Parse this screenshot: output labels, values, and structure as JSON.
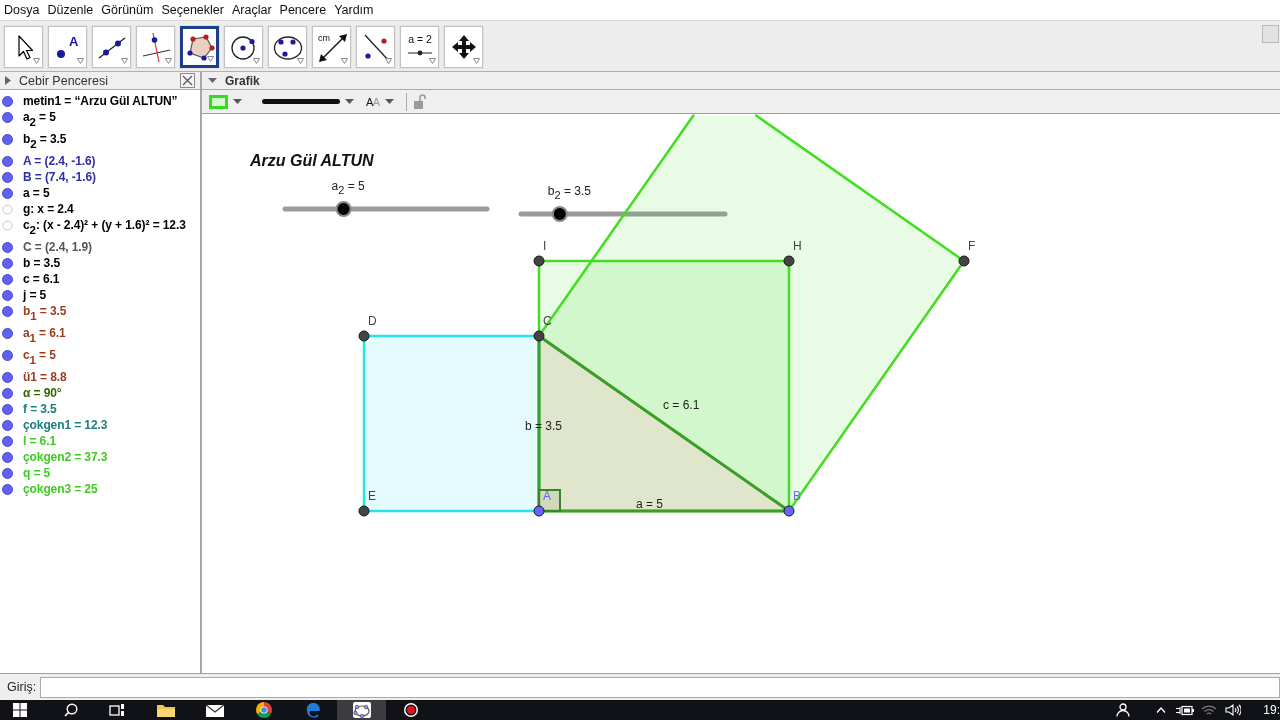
{
  "menu": [
    "Dosya",
    "Düzenle",
    "Görünüm",
    "Seçenekler",
    "Araçlar",
    "Pencere",
    "Yardım"
  ],
  "toolbar": {
    "tools": [
      {
        "kind": "move",
        "selected": false
      },
      {
        "kind": "point",
        "glyph": "A",
        "selected": false
      },
      {
        "kind": "line",
        "selected": false
      },
      {
        "kind": "perpendicular",
        "selected": false
      },
      {
        "kind": "polygon",
        "selected": true
      },
      {
        "kind": "circle_center",
        "selected": false
      },
      {
        "kind": "circle_three_points",
        "selected": false
      },
      {
        "kind": "distance",
        "glyph": "cm",
        "selected": false
      },
      {
        "kind": "reflect",
        "selected": false
      },
      {
        "kind": "slider",
        "glyph": "a = 2",
        "selected": false
      },
      {
        "kind": "move_view",
        "selected": false
      }
    ]
  },
  "algebra": {
    "title": "Cebir Penceresi",
    "items": [
      {
        "text": "metin1 = “Arzu Gül ALTUN”",
        "visible": true,
        "color": "#000000"
      },
      {
        "text": "a$_{2}$ = 5",
        "visible": true,
        "color": "#000000"
      },
      {
        "text": "b$_{2}$ = 3.5",
        "visible": true,
        "color": "#000000"
      },
      {
        "text": "A = (2.4, -1.6)",
        "visible": true,
        "color": "#2e2ea6"
      },
      {
        "text": "B = (7.4, -1.6)",
        "visible": true,
        "color": "#2e2ea6"
      },
      {
        "text": "a = 5",
        "visible": true,
        "color": "#000000"
      },
      {
        "text": "g: x = 2.4",
        "visible": false,
        "color": "#000000"
      },
      {
        "text": "c$_{2}$: (x - 2.4)² + (y + 1.6)² = 12.3",
        "visible": false,
        "color": "#000000"
      },
      {
        "text": "C = (2.4, 1.9)",
        "visible": true,
        "color": "#555555"
      },
      {
        "text": "b = 3.5",
        "visible": true,
        "color": "#000000"
      },
      {
        "text": "c = 6.1",
        "visible": true,
        "color": "#000000"
      },
      {
        "text": "j = 5",
        "visible": true,
        "color": "#000000"
      },
      {
        "text": "b$_{1}$ = 3.5",
        "visible": true,
        "color": "#993d1f"
      },
      {
        "text": "a$_{1}$ = 6.1",
        "visible": true,
        "color": "#993d1f"
      },
      {
        "text": "c$_{1}$ = 5",
        "visible": true,
        "color": "#993d1f"
      },
      {
        "text": "ü1 = 8.8",
        "visible": true,
        "color": "#993d1f"
      },
      {
        "text": "α = 90°",
        "visible": true,
        "color": "#2f6a00"
      },
      {
        "text": "f = 3.5",
        "visible": true,
        "color": "#1c7f7f"
      },
      {
        "text": "çokgen1 = 12.3",
        "visible": true,
        "color": "#1c7f7f"
      },
      {
        "text": "l = 6.1",
        "visible": true,
        "color": "#3dcc1f"
      },
      {
        "text": "çokgen2 = 37.3",
        "visible": true,
        "color": "#3dcc1f"
      },
      {
        "text": "q = 5",
        "visible": true,
        "color": "#3dcc1f"
      },
      {
        "text": "çokgen3 = 25",
        "visible": true,
        "color": "#3dcc1f"
      }
    ]
  },
  "graphics": {
    "title": "Grafik",
    "style_bar": {
      "text_size": "AA"
    },
    "canvas": {
      "text": "Arzu Gül ALTUN",
      "sliders": [
        {
          "label": "a$_{2}$ = 5",
          "level": 0.29
        },
        {
          "label": "b$_{2}$ = 3.5",
          "level": 0.19
        }
      ],
      "polygons": [
        {
          "kind": "square",
          "color": "#44dd22"
        },
        {
          "kind": "square",
          "color": "#44dd22"
        },
        {
          "kind": "square",
          "color": "#22e5ee"
        },
        {
          "kind": "triangle",
          "color": "#3a9e28"
        }
      ],
      "segment_labels": [
        "c = 6.1",
        "b = 3.5",
        "a = 5"
      ],
      "points": [
        {
          "label": "I",
          "color": "#444444"
        },
        {
          "label": "H",
          "color": "#444444"
        },
        {
          "label": "F",
          "color": "#444444"
        },
        {
          "label": "D",
          "color": "#444444"
        },
        {
          "label": "C",
          "color": "#444444"
        },
        {
          "label": "E",
          "color": "#444444"
        },
        {
          "label": "A",
          "color": "#6666ff"
        },
        {
          "label": "B",
          "color": "#6666ff"
        }
      ]
    }
  },
  "input_bar": {
    "label": "Giriş:"
  },
  "taskbar": {
    "items": [
      {
        "kind": "start",
        "selected": false
      },
      {
        "kind": "search",
        "selected": false
      },
      {
        "kind": "taskview",
        "selected": false
      },
      {
        "kind": "folder",
        "selected": false
      },
      {
        "kind": "mail",
        "selected": false
      },
      {
        "kind": "chromium",
        "selected": false
      },
      {
        "kind": "wave",
        "selected": false
      },
      {
        "kind": "geometry",
        "selected": true
      },
      {
        "kind": "recorder",
        "selected": false
      }
    ],
    "tray": [
      {
        "kind": "people"
      },
      {
        "kind": "chevron"
      },
      {
        "kind": "battery"
      },
      {
        "kind": "wifi"
      },
      {
        "kind": "speaker"
      }
    ],
    "clock": "19:"
  }
}
